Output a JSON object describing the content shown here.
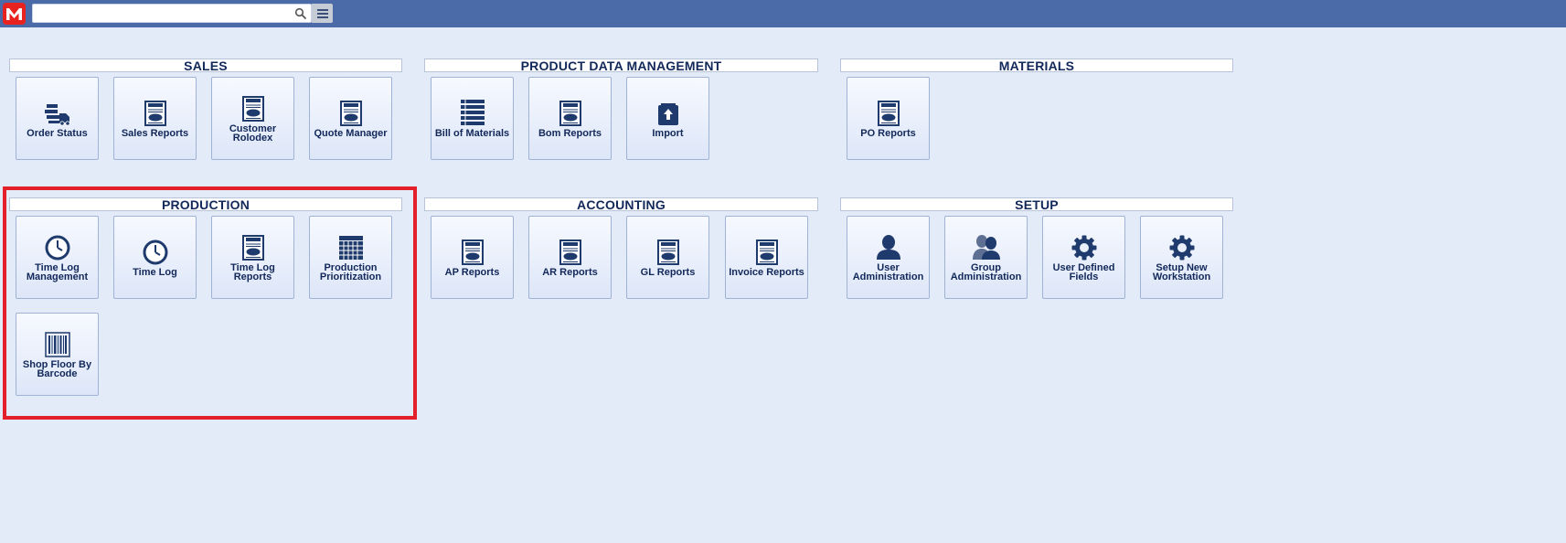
{
  "app": {
    "logo_letter": "M",
    "search": {
      "value": "",
      "placeholder": ""
    },
    "colors": {
      "topbar": "#4a6aa8",
      "logo": "#e8231f",
      "highlight": "#e3202a",
      "icon": "#1f3a6d"
    }
  },
  "sections": {
    "sales": {
      "title": "SALES",
      "tiles": [
        {
          "label": "Order Status",
          "icon": "truck-boxes-icon"
        },
        {
          "label": "Sales Reports",
          "icon": "reports-icon"
        },
        {
          "label": "Customer Rolodex",
          "icon": "reports-icon"
        },
        {
          "label": "Quote Manager",
          "icon": "reports-icon"
        }
      ]
    },
    "pdm": {
      "title": "PRODUCT DATA MANAGEMENT",
      "tiles": [
        {
          "label": "Bill of Materials",
          "icon": "stacked-list-icon"
        },
        {
          "label": "Bom Reports",
          "icon": "reports-icon"
        },
        {
          "label": "Import",
          "icon": "import-icon"
        }
      ]
    },
    "materials": {
      "title": "MATERIALS",
      "tiles": [
        {
          "label": "PO Reports",
          "icon": "reports-icon"
        }
      ]
    },
    "production": {
      "title": "PRODUCTION",
      "tiles": [
        {
          "label": "Time Log Management",
          "icon": "clock-icon"
        },
        {
          "label": "Time Log",
          "icon": "clock-icon"
        },
        {
          "label": "Time Log Reports",
          "icon": "reports-icon"
        },
        {
          "label": "Production Prioritization",
          "icon": "calendar-grid-icon"
        },
        {
          "label": "Shop Floor By Barcode",
          "icon": "barcode-icon"
        }
      ]
    },
    "accounting": {
      "title": "ACCOUNTING",
      "tiles": [
        {
          "label": "AP Reports",
          "icon": "reports-icon"
        },
        {
          "label": "AR Reports",
          "icon": "reports-icon"
        },
        {
          "label": "GL Reports",
          "icon": "reports-icon"
        },
        {
          "label": "Invoice Reports",
          "icon": "reports-icon"
        }
      ]
    },
    "setup": {
      "title": "SETUP",
      "tiles": [
        {
          "label": "User Administration",
          "icon": "user-icon"
        },
        {
          "label": "Group Administration",
          "icon": "group-icon"
        },
        {
          "label": "User Defined Fields",
          "icon": "gear-icon"
        },
        {
          "label": "Setup New Workstation",
          "icon": "gear-icon"
        }
      ]
    }
  }
}
